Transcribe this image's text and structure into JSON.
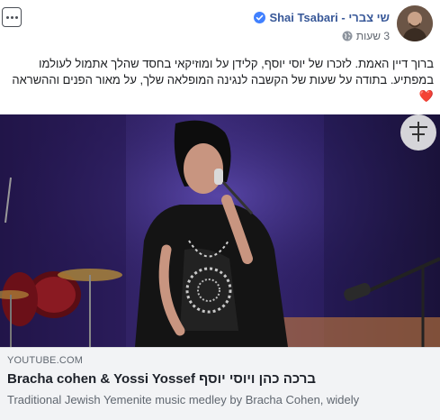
{
  "post": {
    "author_name": "Shai Tsabari - שי צברי",
    "timestamp": "3 שעות",
    "icons": {
      "verified": "verified-badge-icon",
      "privacy": "globe-icon",
      "more": "more-options-icon"
    },
    "text": "ברוך דיין האמת. לזכרו של יוסי יוסף, קלידן על ומוזיקאי בחסד שהלך אתמול לעולמו במפתיע. בתודה על שעות של הקשבה לנגינה המופלאה שלך, על מאור הפנים וההשראה",
    "emoji": "❤️"
  },
  "link_preview": {
    "domain": "YOUTUBE.COM",
    "title": "Bracha cohen & Yossi Yossef ברכה כהן ויוסי יוסף",
    "description": "Traditional Jewish Yemenite music medley by Bracha Cohen, widely"
  },
  "colors": {
    "author_link": "#385898",
    "verified": "#4080ff",
    "meta_text": "#616770",
    "link_box_bg": "#f2f3f5"
  }
}
